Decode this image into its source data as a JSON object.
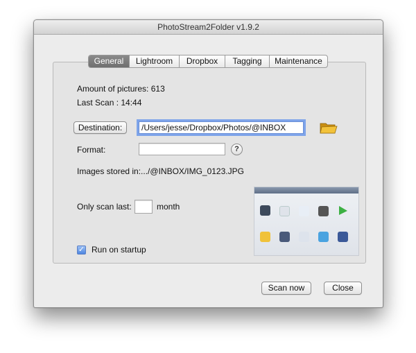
{
  "window": {
    "title": "PhotoStream2Folder v1.9.2"
  },
  "tabs": [
    {
      "label": "General",
      "active": true
    },
    {
      "label": "Lightroom",
      "active": false
    },
    {
      "label": "Dropbox",
      "active": false
    },
    {
      "label": "Tagging",
      "active": false
    },
    {
      "label": "Maintenance",
      "active": false
    }
  ],
  "general": {
    "amount_label": "Amount of pictures: 613",
    "last_scan_label": "Last Scan : 14:44",
    "destination_button": "Destination:",
    "destination_value": "/Users/jesse/Dropbox/Photos/@INBOX",
    "format_label": "Format:",
    "format_value": "",
    "help_label": "?",
    "stored_in_label": "Images stored in:.../@INBOX/IMG_0123.JPG",
    "only_scan_label": "Only scan last:",
    "only_scan_value": "",
    "month_label": "month",
    "run_on_startup_label": "Run on startup",
    "run_on_startup_checked": true
  },
  "footer": {
    "scan_now_label": "Scan now",
    "close_label": "Close"
  },
  "icons": {
    "folder": "folder-icon",
    "checkmark": "checkmark-icon",
    "share_sheet": "share-sheet-preview-image"
  },
  "colors": {
    "tab_active": "#7a7a7a",
    "focus_ring": "#7ea4ea",
    "folder": "#e9b42a"
  }
}
